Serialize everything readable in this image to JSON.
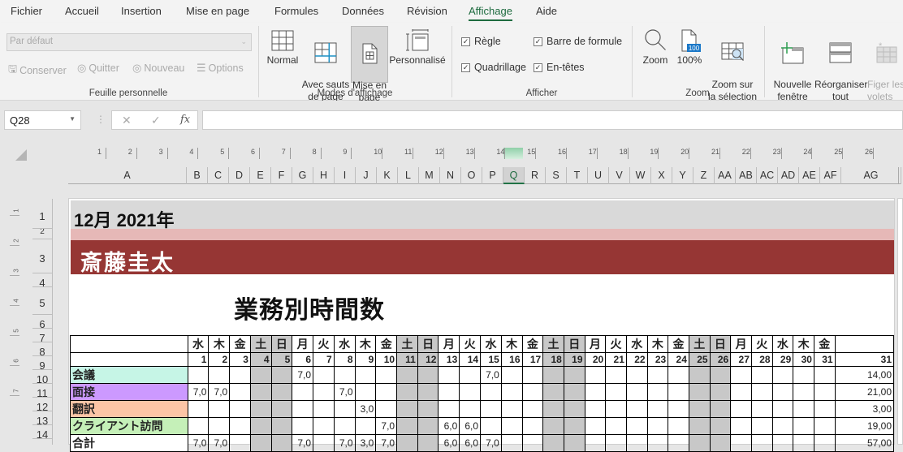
{
  "menu": {
    "tabs": [
      "Fichier",
      "Accueil",
      "Insertion",
      "Mise en page",
      "Formules",
      "Données",
      "Révision",
      "Affichage",
      "Aide"
    ],
    "active": "Affichage"
  },
  "ribbon": {
    "sheet_view": {
      "select_value": "Par défaut",
      "buttons": [
        {
          "label": "Conserver",
          "icon": "save-icon"
        },
        {
          "label": "Quitter",
          "icon": "eye-x-icon"
        },
        {
          "label": "Nouveau",
          "icon": "eye-plus-icon"
        },
        {
          "label": "Options",
          "icon": "list-icon"
        }
      ],
      "group_label": "Feuille personnelle"
    },
    "workbook_views": {
      "buttons": [
        {
          "label": "Normal",
          "icon": "grid-icon"
        },
        {
          "label": "Avec sauts\nde page",
          "icon": "page-break-icon"
        },
        {
          "label": "Mise en\npage",
          "icon": "page-layout-icon",
          "selected": true
        },
        {
          "label": "Personnalisé",
          "icon": "custom-view-icon"
        }
      ],
      "group_label": "Modes d'affichage"
    },
    "show": {
      "checkboxes": [
        {
          "label": "Règle",
          "checked": true
        },
        {
          "label": "Barre de formule",
          "checked": true
        },
        {
          "label": "Quadrillage",
          "checked": true
        },
        {
          "label": "En-têtes",
          "checked": true
        }
      ],
      "group_label": "Afficher"
    },
    "zoom": {
      "buttons": [
        {
          "label": "Zoom",
          "icon": "magnifier-icon"
        },
        {
          "label": "100%",
          "icon": "zoom-100-icon",
          "badge": "100"
        },
        {
          "label": "Zoom sur\nla sélection",
          "icon": "zoom-selection-icon"
        }
      ],
      "group_label": "Zoom"
    },
    "window": {
      "buttons": [
        {
          "label": "Nouvelle\nfenêtre",
          "icon": "new-window-icon"
        },
        {
          "label": "Réorganiser\ntout",
          "icon": "arrange-all-icon"
        },
        {
          "label": "Figer les\nvolets",
          "icon": "freeze-panes-icon",
          "disabled": true
        }
      ]
    }
  },
  "formula_bar": {
    "name_box": "Q28",
    "formula": "",
    "fx": "fx",
    "cancel": "✕",
    "enter": "✓"
  },
  "ruler": {
    "h_numbers": [
      1,
      2,
      3,
      4,
      5,
      6,
      7,
      8,
      9,
      10,
      11,
      12,
      13,
      14,
      15,
      16,
      17,
      18,
      19,
      20,
      21,
      22,
      23,
      24,
      25,
      26
    ],
    "v_numbers": [
      1,
      2,
      3,
      4,
      5,
      6,
      7
    ]
  },
  "columns": [
    "A",
    "B",
    "C",
    "D",
    "E",
    "F",
    "G",
    "H",
    "I",
    "J",
    "K",
    "L",
    "M",
    "N",
    "O",
    "P",
    "Q",
    "R",
    "S",
    "T",
    "U",
    "V",
    "W",
    "X",
    "Y",
    "Z",
    "AA",
    "AB",
    "AC",
    "AD",
    "AE",
    "AF",
    "AG"
  ],
  "selected_column": "Q",
  "rows": [
    1,
    2,
    3,
    4,
    5,
    6,
    7,
    8,
    9,
    10,
    11,
    12,
    13,
    14
  ],
  "sheet": {
    "month_year": "12月 2021年",
    "person": "斎藤圭太",
    "title": "業務別時間数",
    "weekdays": [
      "水",
      "木",
      "金",
      "土",
      "日",
      "月",
      "火",
      "水",
      "木",
      "金",
      "土",
      "日",
      "月",
      "火",
      "水",
      "木",
      "金",
      "土",
      "日",
      "月",
      "火",
      "水",
      "木",
      "金",
      "土",
      "日",
      "月",
      "火",
      "水",
      "木",
      "金"
    ],
    "days": [
      1,
      2,
      3,
      4,
      5,
      6,
      7,
      8,
      9,
      10,
      11,
      12,
      13,
      14,
      15,
      16,
      17,
      18,
      19,
      20,
      21,
      22,
      23,
      24,
      25,
      26,
      27,
      28,
      29,
      30,
      31
    ],
    "weekend_days": [
      4,
      5,
      11,
      12,
      18,
      19,
      25,
      26
    ],
    "total_header": "31",
    "tasks": [
      {
        "name": "会議",
        "color": "#c6f5e6",
        "hours": {
          "6": "7,0",
          "15": "7,0"
        },
        "total": "14,00"
      },
      {
        "name": "面接",
        "color": "#cc99ff",
        "hours": {
          "1": "7,0",
          "2": "7,0",
          "8": "7,0"
        },
        "total": "21,00"
      },
      {
        "name": "翻訳",
        "color": "#fcc5a6",
        "hours": {
          "9": "3,0"
        },
        "total": "3,00"
      },
      {
        "name": "クライアント訪問",
        "color": "#c5f0b8",
        "hours": {
          "10": "7,0",
          "13": "6,0",
          "14": "6,0"
        },
        "total": "19,00"
      },
      {
        "name": "合計",
        "color": "#ffffff",
        "hours": {
          "1": "7,0",
          "2": "7,0",
          "6": "7,0",
          "8": "7,0",
          "9": "3,0",
          "10": "7,0",
          "13": "6,0",
          "14": "6,0",
          "15": "7,0"
        },
        "total": "57,00"
      }
    ]
  },
  "colors": {
    "accent_green": "#217346",
    "header_band": "#d9d9d9",
    "pink_band": "#e6b8b7",
    "name_band": "#963634",
    "weekend": "#c8c8c8"
  }
}
